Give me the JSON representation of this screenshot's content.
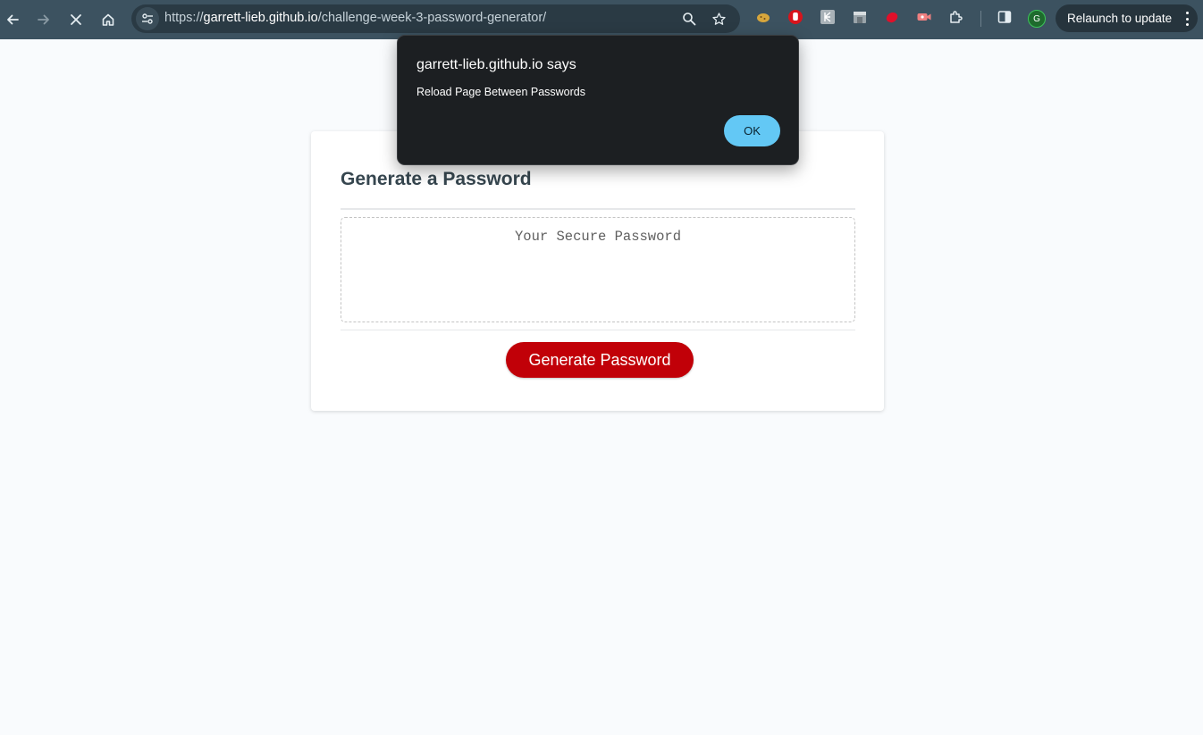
{
  "browser": {
    "url_scheme": "https://",
    "url_host": "garrett-lieb.github.io",
    "url_path": "/challenge-week-3-password-generator/",
    "relaunch_label": "Relaunch to update",
    "profile_initial": "G",
    "icons": {
      "back": "back-arrow-icon",
      "forward": "forward-arrow-icon",
      "stop": "close-icon",
      "home": "home-icon",
      "site_info": "tune-icon",
      "zoom": "magnifier-icon",
      "bookmark": "star-icon",
      "extensions": "puzzle-icon",
      "side_panel": "side-panel-icon",
      "menu": "vertical-dots-icon"
    }
  },
  "page": {
    "title": "Generate a Password",
    "password_placeholder": "Your Secure Password",
    "generate_label": "Generate Password",
    "colors": {
      "button": "#c10008",
      "title": "#36464f",
      "background": "#f9fbfd"
    }
  },
  "dialog": {
    "title": "garrett-lieb.github.io says",
    "message": "Reload Page Between Passwords",
    "ok_label": "OK",
    "colors": {
      "background": "#1c1f22",
      "ok_button": "#63c8f5"
    }
  }
}
